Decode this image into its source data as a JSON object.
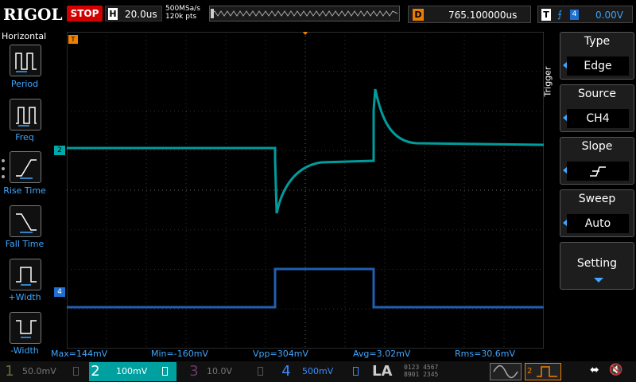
{
  "header": {
    "logo": "RIGOL",
    "run_state": "STOP",
    "horizontal_label": "H",
    "timebase": "20.0us",
    "sample_rate": "500MSa/s",
    "points": "120k pts",
    "delay_label": "D",
    "delay_value": "765.100000us",
    "trigger_label": "T",
    "trigger_source_num": "4",
    "trigger_level": "0.00V"
  },
  "left_menu": {
    "title": "Horizontal",
    "items": [
      {
        "label": "Period",
        "icon": "period-icon"
      },
      {
        "label": "Freq",
        "icon": "freq-icon"
      },
      {
        "label": "Rise Time",
        "icon": "rise-time-icon"
      },
      {
        "label": "Fall Time",
        "icon": "fall-time-icon"
      },
      {
        "label": "+Width",
        "icon": "positive-width-icon"
      },
      {
        "label": "-Width",
        "icon": "negative-width-icon"
      }
    ]
  },
  "right_menu": {
    "title": "Trigger",
    "items": [
      {
        "title": "Type",
        "value": "Edge"
      },
      {
        "title": "Source",
        "value": "CH4"
      },
      {
        "title": "Slope",
        "value": "rising-edge-icon"
      },
      {
        "title": "Sweep",
        "value": "Auto"
      },
      {
        "title": "Setting",
        "value": ""
      }
    ]
  },
  "markers": {
    "ch2": "2",
    "ch4": "4",
    "trigger_top": "T"
  },
  "measurements": {
    "max": "Max=144mV",
    "min": "Min=-160mV",
    "vpp": "Vpp=304mV",
    "avg": "Avg=3.02mV",
    "rms": "Rms=30.6mV"
  },
  "channels": [
    {
      "num": "1",
      "value": "50.0mV",
      "color": "#d4c000",
      "active": false
    },
    {
      "num": "2",
      "value": "100mV",
      "color": "#00c8c8",
      "active": true
    },
    {
      "num": "3",
      "value": "10.0V",
      "color": "#d040d0",
      "active": false
    },
    {
      "num": "4",
      "value": "500mV",
      "color": "#3a8cff",
      "active": false
    }
  ],
  "bottom": {
    "la_label": "LA",
    "la_row1": "0123 4567",
    "la_row2": "8901 2345",
    "gen_label": "2"
  },
  "colors": {
    "ch2_trace": "#009c9c",
    "ch4_trace": "#1f5fb0",
    "accent": "#3fa7ff",
    "trigger": "#f08000"
  }
}
